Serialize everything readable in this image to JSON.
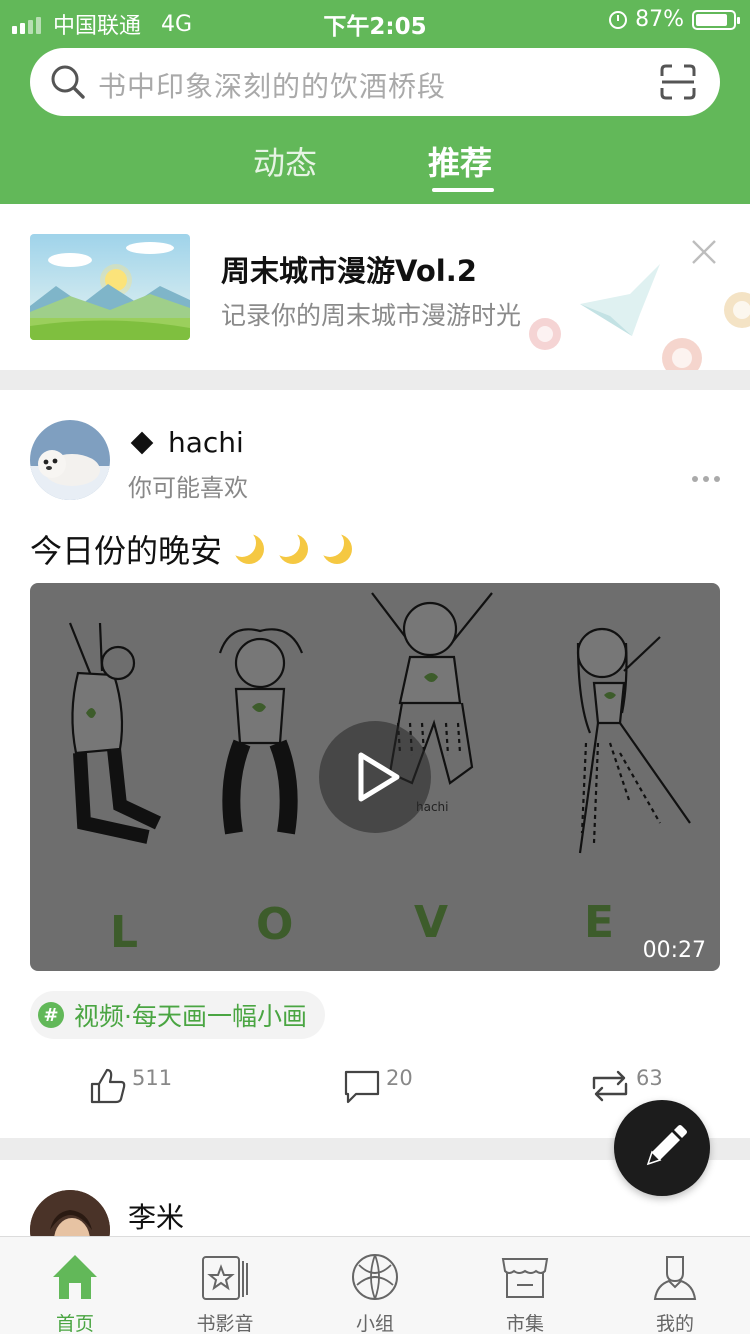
{
  "status_bar": {
    "carrier": "中国联通",
    "network": "4G",
    "time": "下午2:05",
    "battery": "87%",
    "battery_level": 0.87
  },
  "search": {
    "placeholder": "书中印象深刻的的饮酒桥段",
    "search_icon": "search-icon",
    "scan_icon": "scan-icon"
  },
  "tabs": [
    {
      "label": "动态",
      "active": false
    },
    {
      "label": "推荐",
      "active": true
    }
  ],
  "banner": {
    "title": "周末城市漫游Vol.2",
    "subtitle": "记录你的周末城市漫游时光",
    "close_icon": "close-icon"
  },
  "post": {
    "username": "hachi",
    "reason": "你可能喜欢",
    "text": "今日份的晚安",
    "emoji": "🌙🌙🌙",
    "video_duration": "00:27",
    "video_watermark": "hachi",
    "video_letters": [
      "L",
      "O",
      "V",
      "E"
    ],
    "topic": "视频·每天画一幅小画",
    "likes": "511",
    "comments": "20",
    "reposts": "63"
  },
  "next_post": {
    "username": "李米"
  },
  "tabbar": [
    {
      "label": "首页",
      "icon": "home-icon",
      "active": true
    },
    {
      "label": "书影音",
      "icon": "book-film-music-icon",
      "active": false
    },
    {
      "label": "小组",
      "icon": "group-icon",
      "active": false
    },
    {
      "label": "市集",
      "icon": "market-icon",
      "active": false
    },
    {
      "label": "我的",
      "icon": "profile-icon",
      "active": false
    }
  ],
  "colors": {
    "brand_green": "#62b859",
    "topic_green": "#4aa542",
    "fab": "#1c1c1c"
  }
}
